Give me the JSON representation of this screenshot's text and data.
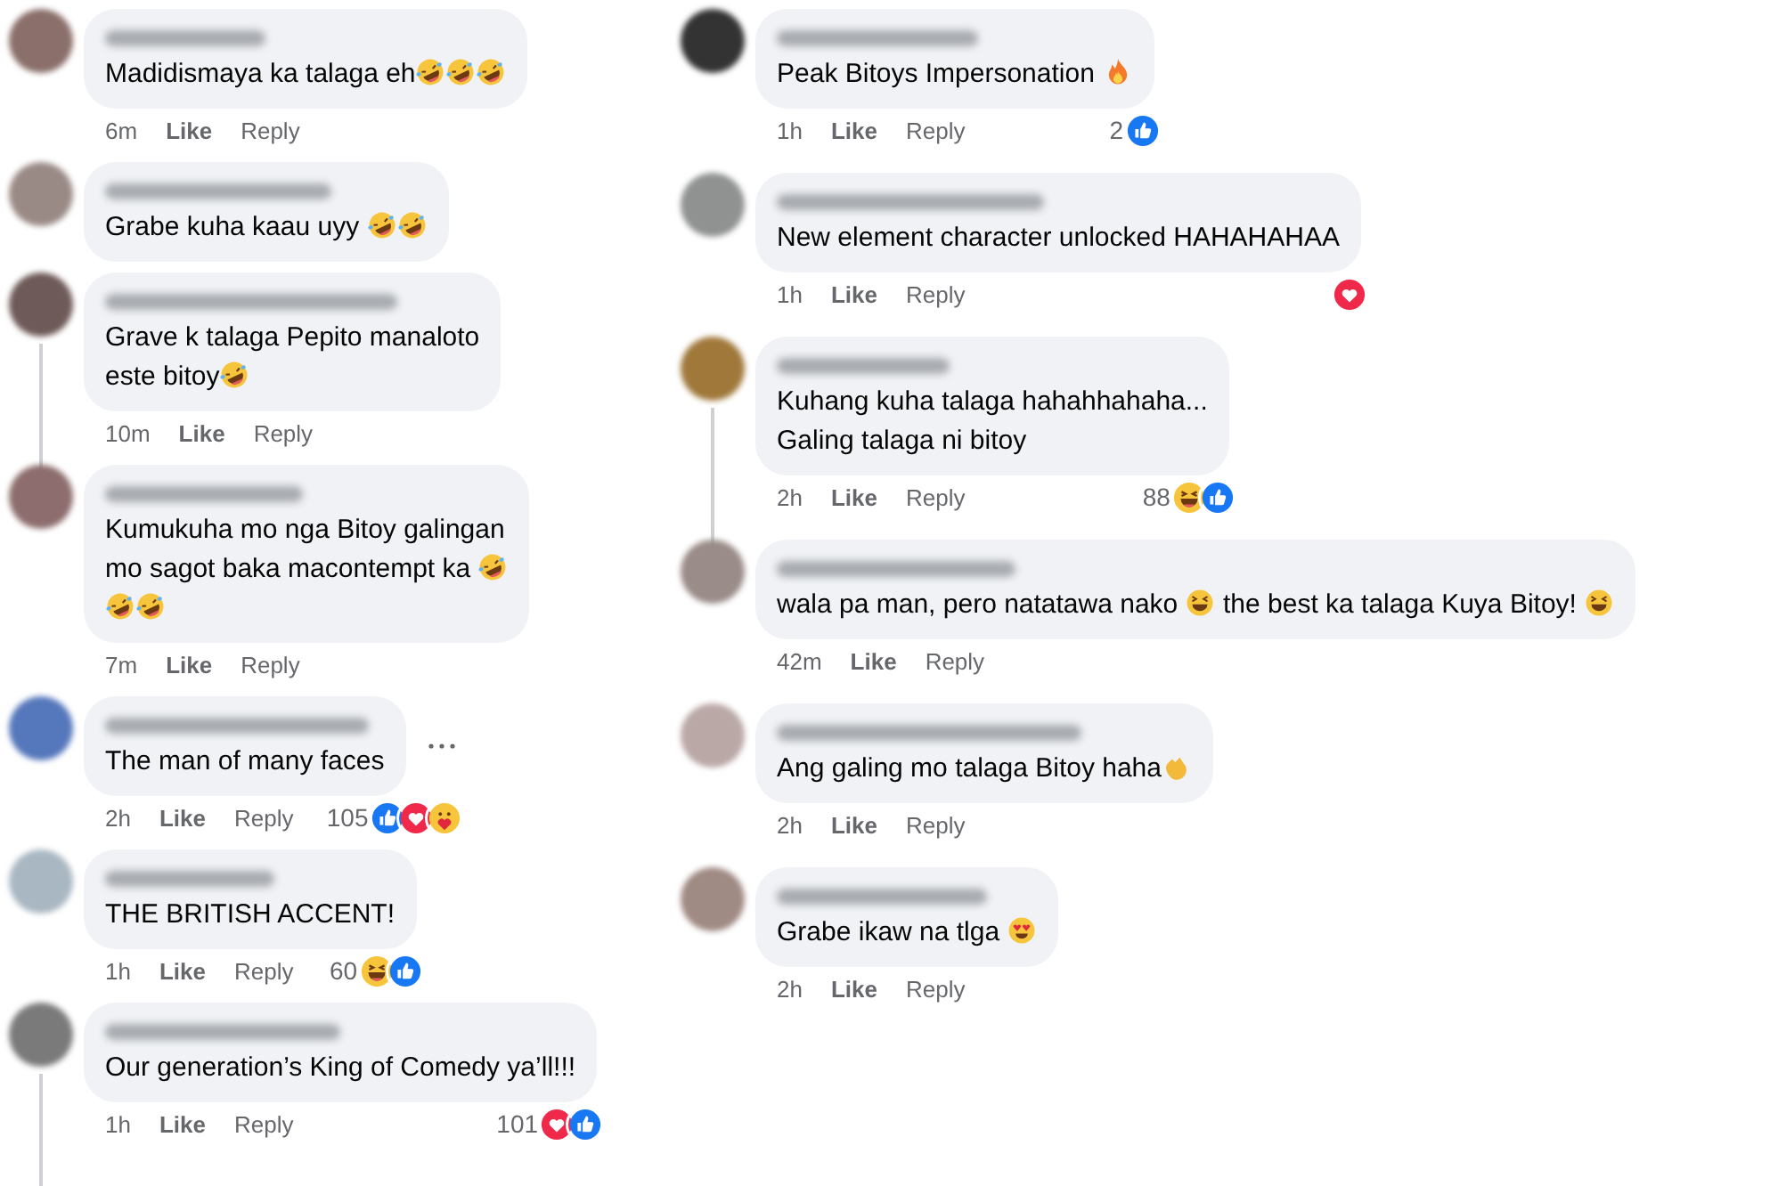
{
  "columns": [
    {
      "comments": [
        {
          "parts": [
            {
              "kind": "text",
              "text": "Madidismaya ka talaga eh"
            },
            {
              "kind": "rofl"
            },
            {
              "kind": "rofl"
            },
            {
              "kind": "rofl"
            }
          ],
          "time": "6m",
          "like": "Like",
          "reply": "Reply",
          "thread_line": false
        },
        {
          "parts": [
            {
              "kind": "text",
              "text": "Grabe kuha kaau uyy "
            },
            {
              "kind": "rofl"
            },
            {
              "kind": "rofl"
            }
          ],
          "thread_line": false
        },
        {
          "parts": [
            {
              "kind": "text",
              "text": "Grave k talaga Pepito manaloto"
            },
            {
              "kind": "break"
            },
            {
              "kind": "text",
              "text": "este bitoy"
            },
            {
              "kind": "rofl"
            }
          ],
          "time": "10m",
          "like": "Like",
          "reply": "Reply",
          "thread_line": true
        },
        {
          "parts": [
            {
              "kind": "text",
              "text": "Kumukuha mo nga Bitoy galingan"
            },
            {
              "kind": "break"
            },
            {
              "kind": "text",
              "text": "mo sagot baka macontempt ka "
            },
            {
              "kind": "rofl"
            },
            {
              "kind": "break"
            },
            {
              "kind": "rofl"
            },
            {
              "kind": "rofl"
            }
          ],
          "time": "7m",
          "like": "Like",
          "reply": "Reply",
          "thread_line": false
        },
        {
          "parts": [
            {
              "kind": "text",
              "text": "The man of many faces"
            }
          ],
          "time": "2h",
          "like": "Like",
          "reply": "Reply",
          "thread_line": false,
          "more_button": true,
          "count": "105",
          "reactions": [
            {
              "kind": "like"
            },
            {
              "kind": "love"
            },
            {
              "kind": "care"
            }
          ]
        },
        {
          "parts": [
            {
              "kind": "text",
              "text": "THE BRITISH ACCENT!"
            }
          ],
          "time": "1h",
          "like": "Like",
          "reply": "Reply",
          "thread_line": false,
          "count": "60",
          "reactions": [
            {
              "kind": "haha"
            },
            {
              "kind": "like"
            }
          ]
        },
        {
          "parts": [
            {
              "kind": "text",
              "text": "Our generation’s King of Comedy ya’ll!!!"
            }
          ],
          "time": "1h",
          "like": "Like",
          "reply": "Reply",
          "thread_line": true,
          "count": "101",
          "reactions": [
            {
              "kind": "love"
            },
            {
              "kind": "like"
            }
          ]
        }
      ]
    },
    {
      "comments": [
        {
          "parts": [
            {
              "kind": "text",
              "text": "Peak Bitoys Impersonation "
            },
            {
              "kind": "fire"
            }
          ],
          "time": "1h",
          "like": "Like",
          "reply": "Reply",
          "thread_line": false,
          "count": "2",
          "reactions": [
            {
              "kind": "like"
            }
          ]
        },
        {
          "parts": [
            {
              "kind": "text",
              "text": "New element character unlocked HAHAHAHAA"
            }
          ],
          "time": "1h",
          "like": "Like",
          "reply": "Reply",
          "thread_line": false,
          "reactions": [
            {
              "kind": "love"
            }
          ]
        },
        {
          "parts": [
            {
              "kind": "text",
              "text": "Kuhang kuha talaga hahahhahaha...\nGaling talaga ni bitoy"
            }
          ],
          "time": "2h",
          "like": "Like",
          "reply": "Reply",
          "thread_line": true,
          "count": "88",
          "reactions": [
            {
              "kind": "haha"
            },
            {
              "kind": "like"
            }
          ]
        },
        {
          "parts": [
            {
              "kind": "text",
              "text": "wala pa man, pero natatawa nako "
            },
            {
              "kind": "laugh"
            },
            {
              "kind": "text",
              "text": " the best ka talaga Kuya Bitoy! "
            },
            {
              "kind": "laugh"
            }
          ],
          "time": "42m",
          "like": "Like",
          "reply": "Reply",
          "thread_line": false
        },
        {
          "parts": [
            {
              "kind": "text",
              "text": "Ang galing mo talaga Bitoy haha"
            },
            {
              "kind": "clap"
            }
          ],
          "time": "2h",
          "like": "Like",
          "reply": "Reply",
          "thread_line": false
        },
        {
          "parts": [
            {
              "kind": "text",
              "text": "Grabe ikaw na tlga "
            },
            {
              "kind": "heart-eyes"
            }
          ],
          "time": "2h",
          "like": "Like",
          "reply": "Reply",
          "thread_line": false
        }
      ]
    }
  ]
}
